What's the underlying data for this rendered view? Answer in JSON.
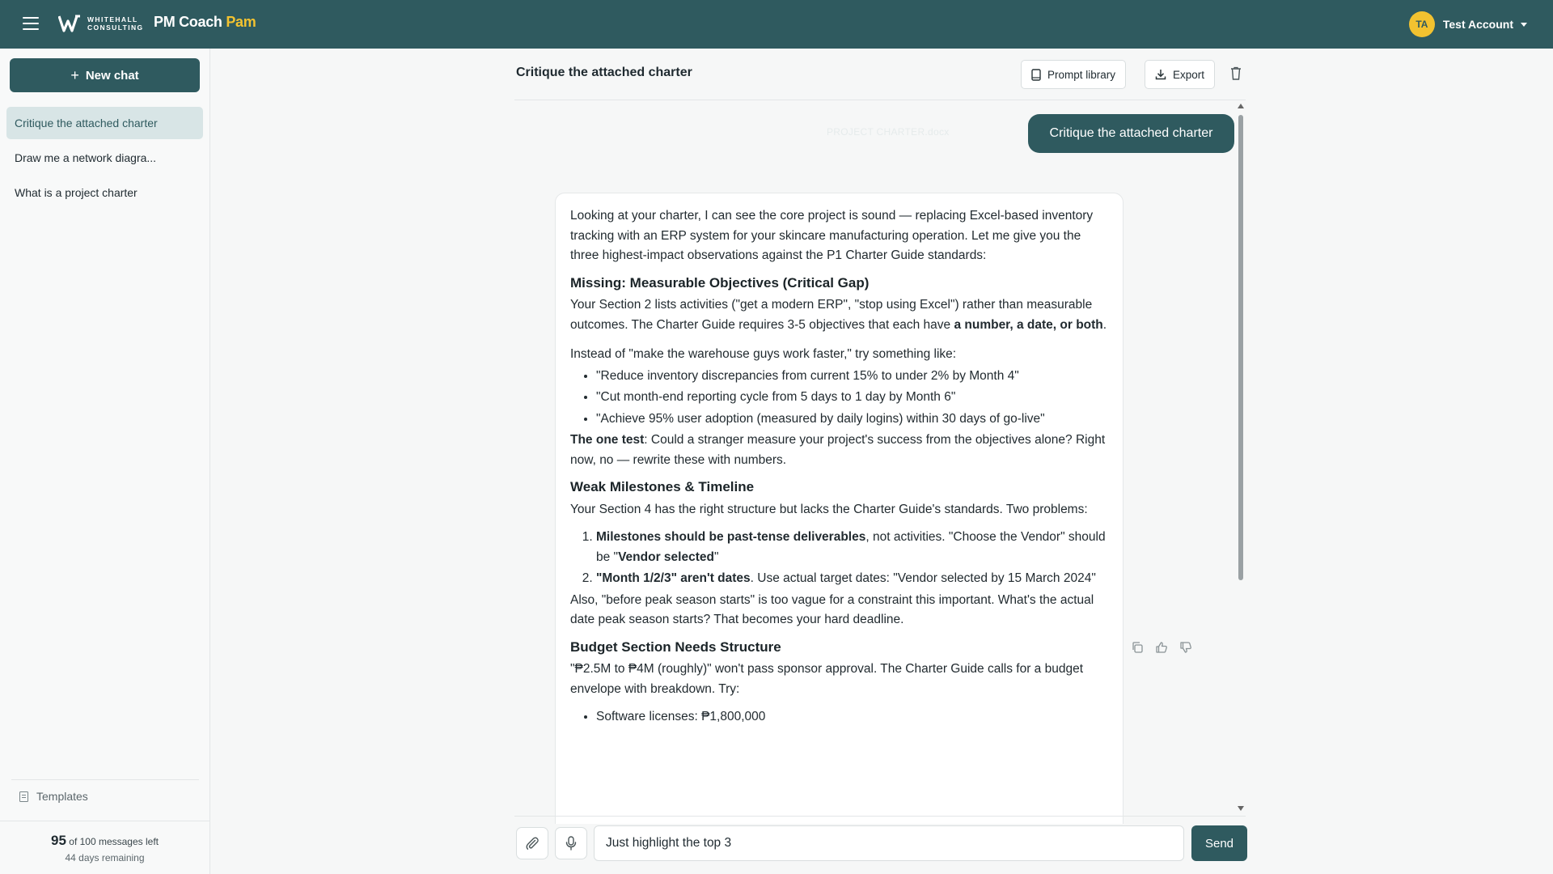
{
  "header": {
    "logo_text_line1": "WHITEHALL",
    "logo_text_line2": "CONSULTING",
    "brand_main": "PM Coach",
    "brand_accent": "Pam",
    "account_initials": "TA",
    "account_name": "Test Account"
  },
  "colors": {
    "primary": "#2f5a5f",
    "accent": "#f2c230",
    "active_item_bg": "#d8e5e6"
  },
  "sidebar": {
    "new_chat_label": "New chat",
    "chats": [
      {
        "label": "Critique the attached charter",
        "active": true
      },
      {
        "label": "Draw me a network diagra...",
        "active": false
      },
      {
        "label": "What is a project charter",
        "active": false
      }
    ],
    "templates_label": "Templates",
    "quota": {
      "count": "95",
      "text": "of 100 messages left",
      "days": "44 days remaining"
    }
  },
  "chat": {
    "title": "Critique the attached charter",
    "prompt_library_label": "Prompt library",
    "export_label": "Export",
    "user_message": "Critique the attached charter",
    "attachment_label": "PROJECT CHARTER.docx",
    "assistant": {
      "intro": "Looking at your charter, I can see the core project is sound — replacing Excel-based inventory tracking with an ERP system for your skincare manufacturing operation. Let me give you the three highest-impact observations against the P1 Charter Guide standards:",
      "h1": "Missing: Measurable Objectives (Critical Gap)",
      "p1_a": "Your Section 2 lists activities (\"get a modern ERP\", \"stop using Excel\") rather than measurable outcomes. The Charter Guide requires 3-5 objectives that each have ",
      "p1_bold": "a number, a date, or both",
      "p1_end": ".",
      "p2": "Instead of \"make the warehouse guys work faster,\" try something like:",
      "bullets1": [
        "\"Reduce inventory discrepancies from current 15% to under 2% by Month 4\"",
        "\"Cut month-end reporting cycle from 5 days to 1 day by Month 6\"",
        "\"Achieve 95% user adoption (measured by daily logins) within 30 days of go-live\""
      ],
      "p3_bold": "The one test",
      "p3_rest": ": Could a stranger measure your project's success from the objectives alone? Right now, no — rewrite these with numbers.",
      "h2": "Weak Milestones & Timeline",
      "p4": "Your Section 4 has the right structure but lacks the Charter Guide's standards. Two problems:",
      "ol1_bold": "Milestones should be past-tense deliverables",
      "ol1_mid": ", not activities. \"Choose the Vendor\" should be \"",
      "ol1_bold2": "Vendor selected",
      "ol1_end": "\"",
      "ol2_bold": "\"Month 1/2/3\" aren't dates",
      "ol2_rest": ". Use actual target dates: \"Vendor selected by 15 March 2024\"",
      "p5": "Also, \"before peak season starts\" is too vague for a constraint this important. What's the actual date peak season starts? That becomes your hard deadline.",
      "h3": "Budget Section Needs Structure",
      "p6": "\"₱2.5M to ₱4M (roughly)\" won't pass sponsor approval. The Charter Guide calls for a budget envelope with breakdown. Try:",
      "bullets2": [
        "Software licenses: ₱1,800,000"
      ]
    },
    "composer": {
      "value": "Just highlight the top 3",
      "send_label": "Send"
    }
  },
  "icons": {
    "menu": "hamburger-icon",
    "copy": "copy-icon",
    "thumbs_up": "thumbs-up-icon",
    "thumbs_down": "thumbs-down-icon",
    "attach": "paperclip-icon",
    "mic": "microphone-icon"
  }
}
